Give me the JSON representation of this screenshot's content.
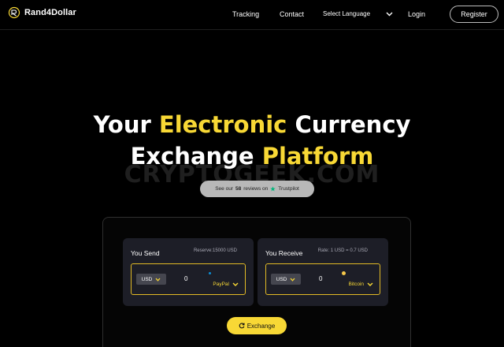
{
  "brand": {
    "name": "Rand4Dollar",
    "accent": "#f8d835"
  },
  "nav": {
    "tracking": "Tracking",
    "contact": "Contact",
    "language": "Select Language",
    "login": "Login",
    "register": "Register"
  },
  "hero": {
    "line1_part1": "Your",
    "line1_highlight": "Electronic",
    "line1_part2": "Currency",
    "line2_part1": "Exchange",
    "line2_highlight": "Platform",
    "watermark": "CRYPTOGEEK.COM"
  },
  "trust": {
    "prefix": "See our",
    "count": "58",
    "suffix": "reviews on",
    "platform": "Trustpilot"
  },
  "send": {
    "title": "You Send",
    "meta": "Reserve:15000 USD",
    "currency": "USD",
    "amount": "0",
    "method": "PayPal"
  },
  "receive": {
    "title": "You Receive",
    "meta": "Rate: 1 USD = 0.7 USD",
    "currency": "USD",
    "amount": "0",
    "method": "Bitcoin"
  },
  "exchange_button": "Exchange"
}
